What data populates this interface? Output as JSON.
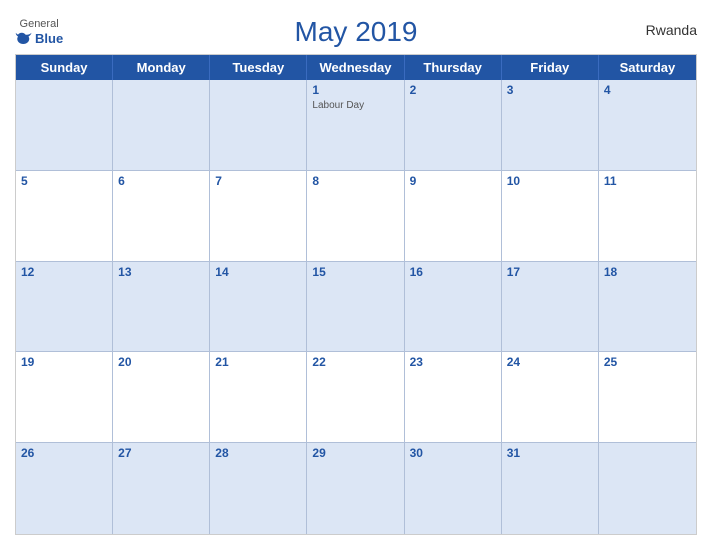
{
  "header": {
    "title": "May 2019",
    "country": "Rwanda",
    "logo": {
      "general": "General",
      "blue": "Blue"
    }
  },
  "dayHeaders": [
    "Sunday",
    "Monday",
    "Tuesday",
    "Wednesday",
    "Thursday",
    "Friday",
    "Saturday"
  ],
  "weeks": [
    [
      {
        "day": "",
        "empty": true
      },
      {
        "day": "",
        "empty": true
      },
      {
        "day": "",
        "empty": true
      },
      {
        "day": "1",
        "holiday": "Labour Day"
      },
      {
        "day": "2"
      },
      {
        "day": "3"
      },
      {
        "day": "4"
      }
    ],
    [
      {
        "day": "5"
      },
      {
        "day": "6"
      },
      {
        "day": "7"
      },
      {
        "day": "8"
      },
      {
        "day": "9"
      },
      {
        "day": "10"
      },
      {
        "day": "11"
      }
    ],
    [
      {
        "day": "12"
      },
      {
        "day": "13"
      },
      {
        "day": "14"
      },
      {
        "day": "15"
      },
      {
        "day": "16"
      },
      {
        "day": "17"
      },
      {
        "day": "18"
      }
    ],
    [
      {
        "day": "19"
      },
      {
        "day": "20"
      },
      {
        "day": "21"
      },
      {
        "day": "22"
      },
      {
        "day": "23"
      },
      {
        "day": "24"
      },
      {
        "day": "25"
      }
    ],
    [
      {
        "day": "26"
      },
      {
        "day": "27"
      },
      {
        "day": "28"
      },
      {
        "day": "29"
      },
      {
        "day": "30"
      },
      {
        "day": "31"
      },
      {
        "day": "",
        "empty": true
      }
    ]
  ],
  "colors": {
    "headerBg": "#2255a4",
    "altRowBg": "#dce6f5"
  }
}
